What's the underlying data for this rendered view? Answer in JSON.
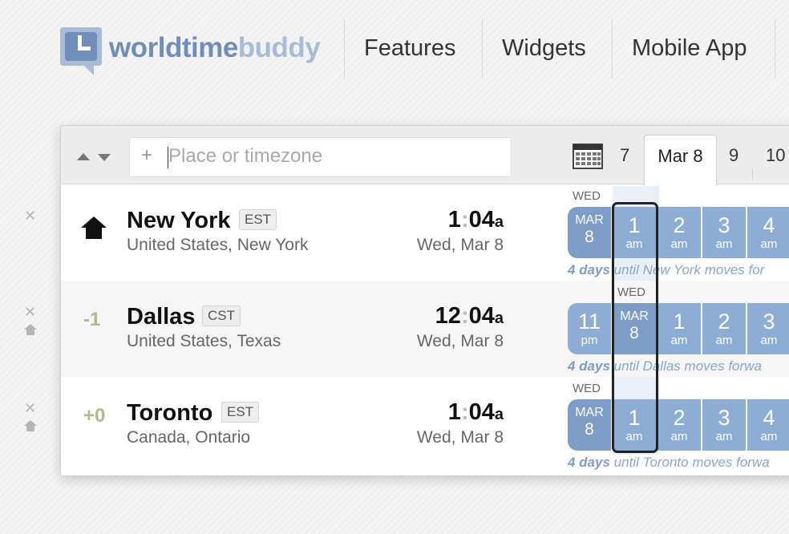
{
  "brand": {
    "part1": "worldtime",
    "part2": "buddy"
  },
  "nav": [
    "Features",
    "Widgets",
    "Mobile App"
  ],
  "toolbar": {
    "search_placeholder": "Place or timezone",
    "plus": "+",
    "dates": {
      "prev": "7",
      "active": "Mar 8",
      "next": "9",
      "next2": "10"
    }
  },
  "rows": [
    {
      "city": "New York",
      "tz": "EST",
      "region": "United States, New York",
      "offset": "",
      "time_h": "1",
      "time_m": "04",
      "ampm": "a",
      "date": "Wed, Mar 8",
      "day_label": "WED",
      "cells": [
        {
          "top": "MAR",
          "bottom": "8",
          "kind": "date"
        },
        {
          "top": "1",
          "bottom": "am"
        },
        {
          "top": "2",
          "bottom": "am"
        },
        {
          "top": "3",
          "bottom": "am"
        },
        {
          "top": "4",
          "bottom": "am"
        }
      ],
      "dst_days": "4 days",
      "dst_rest": " until New York moves for"
    },
    {
      "city": "Dallas",
      "tz": "CST",
      "region": "United States, Texas",
      "offset": "-1",
      "time_h": "12",
      "time_m": "04",
      "ampm": "a",
      "date": "Wed, Mar 8",
      "day_label": "WED",
      "cells": [
        {
          "top": "11",
          "bottom": "pm"
        },
        {
          "top": "MAR",
          "bottom": "8",
          "kind": "date"
        },
        {
          "top": "1",
          "bottom": "am"
        },
        {
          "top": "2",
          "bottom": "am"
        },
        {
          "top": "3",
          "bottom": "am"
        }
      ],
      "dst_days": "4 days",
      "dst_rest": " until Dallas moves forwa"
    },
    {
      "city": "Toronto",
      "tz": "EST",
      "region": "Canada, Ontario",
      "offset": "+0",
      "time_h": "1",
      "time_m": "04",
      "ampm": "a",
      "date": "Wed, Mar 8",
      "day_label": "WED",
      "cells": [
        {
          "top": "MAR",
          "bottom": "8",
          "kind": "date"
        },
        {
          "top": "1",
          "bottom": "am"
        },
        {
          "top": "2",
          "bottom": "am"
        },
        {
          "top": "3",
          "bottom": "am"
        },
        {
          "top": "4",
          "bottom": "am"
        }
      ],
      "dst_days": "4 days",
      "dst_rest": " until Toronto moves forwa"
    }
  ],
  "icons": {
    "remove": "close-icon",
    "home": "home-icon",
    "calendar": "calendar-icon",
    "sort": "sort-arrows-icon"
  },
  "colors": {
    "brand_blue": "#6f8fba",
    "cell_blue": "#8eadd5",
    "note_blue": "#8aa6cc",
    "offset_olive": "#b3b98a"
  }
}
